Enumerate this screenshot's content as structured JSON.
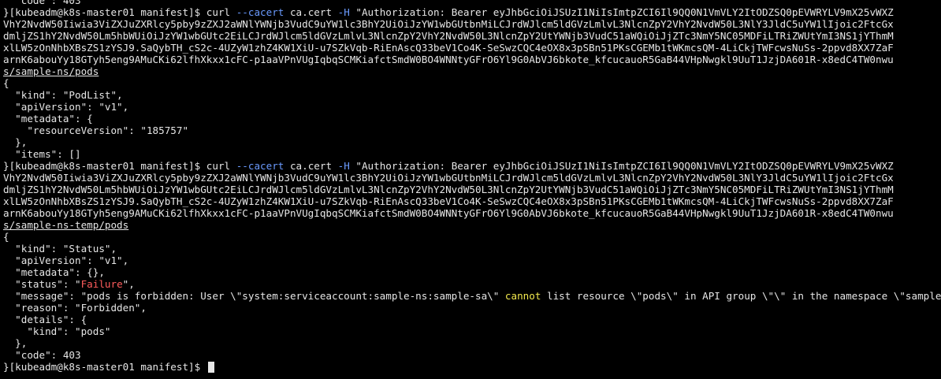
{
  "terminal": {
    "lines": [
      {
        "parts": [
          {
            "t": "  \"code\": 403"
          }
        ]
      },
      {
        "parts": [
          {
            "t": "}[kubeadm@k8s-master01 manifest]$ curl "
          },
          {
            "t": "--cacert",
            "c": "opt"
          },
          {
            "t": " ca.cert "
          },
          {
            "t": "-H",
            "c": "opt"
          },
          {
            "t": " \"Authorization: Bearer eyJhbGciOiJSUzI1NiIsImtpZCI6Il9QQ0N1VmVLY2ItODZSQ0pEVWRYLV9mX25vWXZ"
          }
        ]
      },
      {
        "parts": [
          {
            "t": "VhY2NvdW50Iiwia3ViZXJuZXRlcy5pby9zZXJ2aWNlYWNjb3VudC9uYW1lc3BhY2UiOiJzYW1wbGUtbnMiLCJrdWJlcm5ldGVzLmlvL3NlcnZpY2VhY2NvdW50L3NlY3JldC5uYW1lIjoic2FtcGx"
          }
        ]
      },
      {
        "parts": [
          {
            "t": "dmljZS1hY2NvdW50Lm5hbWUiOiJzYW1wbGUtc2EiLCJrdWJlcm5ldGVzLmlvL3NlcnZpY2VhY2NvdW50L3NlcnZpY2UtYWNjb3VudC51aWQiOiJjZTc3NmY5NC05MDFiLTRiZWUtYmI3NS1jYThmM"
          }
        ]
      },
      {
        "parts": [
          {
            "t": "xlLW5zOnNhbXBsZS1zYSJ9.SaQybTH_cS2c-4UZyW1zhZ4KW1XiU-u7SZkVqb-RiEnAscQ33beV1Co4K-SeSwzCQC4eOX8x3pSBn51PKsCGEMb1tWKmcsQM-4LiCkjTWFcwsNuSs-2ppvd8XX7ZaF"
          }
        ]
      },
      {
        "parts": [
          {
            "t": "arnK6abouYy18GTyh5eng9AMuCKi62lfhXkxx1cFC-p1aaVPnVUgIqbqSCMKiafctSmdW0BO4WNNtyGFrO6Yl9G0AbVJ6bkote_kfcucauoR5GaB44VHpNwgkl9UuT1JzjDA601R-x8edC4TW0nwu"
          }
        ]
      },
      {
        "parts": [
          {
            "t": "s/sample-ns/pods",
            "c": "u"
          }
        ]
      },
      {
        "parts": [
          {
            "t": "{"
          }
        ]
      },
      {
        "parts": [
          {
            "t": "  \"kind\": \"PodList\","
          }
        ]
      },
      {
        "parts": [
          {
            "t": "  \"apiVersion\": \"v1\","
          }
        ]
      },
      {
        "parts": [
          {
            "t": "  \"metadata\": {"
          }
        ]
      },
      {
        "parts": [
          {
            "t": "    \"resourceVersion\": \"185757\""
          }
        ]
      },
      {
        "parts": [
          {
            "t": "  },"
          }
        ]
      },
      {
        "parts": [
          {
            "t": "  \"items\": []"
          }
        ]
      },
      {
        "parts": [
          {
            "t": "}[kubeadm@k8s-master01 manifest]$ curl "
          },
          {
            "t": "--cacert",
            "c": "opt"
          },
          {
            "t": " ca.cert "
          },
          {
            "t": "-H",
            "c": "opt"
          },
          {
            "t": " \"Authorization: Bearer eyJhbGciOiJSUzI1NiIsImtpZCI6Il9QQ0N1VmVLY2ItODZSQ0pEVWRYLV9mX25vWXZ"
          }
        ]
      },
      {
        "parts": [
          {
            "t": "VhY2NvdW50Iiwia3ViZXJuZXRlcy5pby9zZXJ2aWNlYWNjb3VudC9uYW1lc3BhY2UiOiJzYW1wbGUtbnMiLCJrdWJlcm5ldGVzLmlvL3NlcnZpY2VhY2NvdW50L3NlY3JldC5uYW1lIjoic2FtcGx"
          }
        ]
      },
      {
        "parts": [
          {
            "t": "dmljZS1hY2NvdW50Lm5hbWUiOiJzYW1wbGUtc2EiLCJrdWJlcm5ldGVzLmlvL3NlcnZpY2VhY2NvdW50L3NlcnZpY2UtYWNjb3VudC51aWQiOiJjZTc3NmY5NC05MDFiLTRiZWUtYmI3NS1jYThmM"
          }
        ]
      },
      {
        "parts": [
          {
            "t": "xlLW5zOnNhbXBsZS1zYSJ9.SaQybTH_cS2c-4UZyW1zhZ4KW1XiU-u7SZkVqb-RiEnAscQ33beV1Co4K-SeSwzCQC4eOX8x3pSBn51PKsCGEMb1tWKmcsQM-4LiCkjTWFcwsNuSs-2ppvd8XX7ZaF"
          }
        ]
      },
      {
        "parts": [
          {
            "t": "arnK6abouYy18GTyh5eng9AMuCKi62lfhXkxx1cFC-p1aaVPnVUgIqbqSCMKiafctSmdW0BO4WNNtyGFrO6Yl9G0AbVJ6bkote_kfcucauoR5GaB44VHpNwgkl9UuT1JzjDA601R-x8edC4TW0nwu"
          }
        ]
      },
      {
        "parts": [
          {
            "t": "s/sample-ns-temp/pods",
            "c": "u"
          }
        ]
      },
      {
        "parts": [
          {
            "t": "{"
          }
        ]
      },
      {
        "parts": [
          {
            "t": "  \"kind\": \"Status\","
          }
        ]
      },
      {
        "parts": [
          {
            "t": "  \"apiVersion\": \"v1\","
          }
        ]
      },
      {
        "parts": [
          {
            "t": "  \"metadata\": {},"
          }
        ]
      },
      {
        "parts": [
          {
            "t": "  \"status\": \""
          },
          {
            "t": "Failure",
            "c": "fail"
          },
          {
            "t": "\","
          }
        ]
      },
      {
        "parts": [
          {
            "t": "  \"message\": \"pods is forbidden: User \\\"system:serviceaccount:sample-ns:sample-sa\\\" "
          },
          {
            "t": "cannot",
            "c": "warn"
          },
          {
            "t": " list resource \\\"pods\\\" in API group \\\"\\\" in the namespace \\\"sample-ns-temp\\\"\","
          }
        ]
      },
      {
        "parts": [
          {
            "t": "  \"reason\": \"Forbidden\","
          }
        ]
      },
      {
        "parts": [
          {
            "t": "  \"details\": {"
          }
        ]
      },
      {
        "parts": [
          {
            "t": "    \"kind\": \"pods\""
          }
        ]
      },
      {
        "parts": [
          {
            "t": "  },"
          }
        ]
      },
      {
        "parts": [
          {
            "t": "  \"code\": 403"
          }
        ]
      },
      {
        "parts": [
          {
            "t": "}[kubeadm@k8s-master01 manifest]$ "
          }
        ],
        "cursor": true
      }
    ]
  }
}
